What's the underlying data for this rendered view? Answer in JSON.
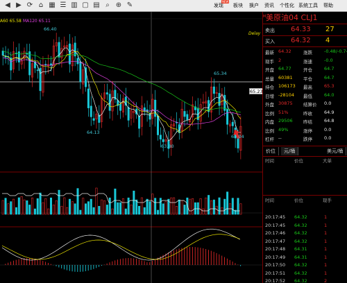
{
  "toolbar": {
    "buttons": [
      {
        "icon": "back-arrow-icon",
        "glyph": "◀"
      },
      {
        "icon": "forward-arrow-icon",
        "glyph": "▶"
      },
      {
        "icon": "refresh-icon",
        "glyph": "⟳"
      },
      {
        "icon": "home-icon",
        "glyph": "⌂"
      },
      {
        "icon": "grid-icon",
        "glyph": "▦"
      },
      {
        "icon": "list-icon",
        "glyph": "☰"
      },
      {
        "icon": "chart-icon",
        "glyph": "▥"
      },
      {
        "icon": "window-icon",
        "glyph": "▢"
      },
      {
        "icon": "layout-icon",
        "glyph": "▤"
      },
      {
        "icon": "search-icon",
        "glyph": "⌕"
      },
      {
        "icon": "zoom-in-icon",
        "glyph": "⊕"
      },
      {
        "icon": "pen-icon",
        "glyph": "✎"
      }
    ],
    "menus": [
      "发现",
      "板块",
      "换户",
      "资讯",
      "个性化",
      "系统工具",
      "帮助"
    ],
    "new_badge": "NEW"
  },
  "chart": {
    "ma_legend": [
      {
        "text": "A60 65.58",
        "color": "#e8e000"
      },
      {
        "text": "MA120 65.11",
        "color": "#e040e0"
      }
    ],
    "delay_label": "Delay",
    "current_price_tag": "65.23",
    "price_labels": [
      {
        "text": "66.40"
      },
      {
        "text": "65.34"
      },
      {
        "text": "64.13"
      },
      {
        "text": "63.80"
      },
      {
        "text": "64.04"
      }
    ]
  },
  "quote": {
    "m_badge": "M",
    "title": "美原油04 CLJ1",
    "sell": {
      "label": "卖出",
      "price": "64.33",
      "volume": "27"
    },
    "buy": {
      "label": "买入",
      "price": "64.32",
      "volume": "4"
    },
    "stats": [
      {
        "l": "最新",
        "v": "64.32",
        "vc": "red",
        "l2": "涨跌",
        "v2": "-0.48/-0.74",
        "v2c": "grn"
      },
      {
        "l": "现手",
        "v": "2",
        "vc": "red",
        "l2": "涨速",
        "v2": "-0.0",
        "v2c": "grn"
      },
      {
        "l": "开盘",
        "v": "64.77",
        "vc": "grn",
        "l2": "开仓",
        "v2": "64.7",
        "v2c": "grn"
      },
      {
        "l": "总量",
        "v": "60381",
        "vc": "yel",
        "l2": "平仓",
        "v2": "64.7",
        "v2c": "grn"
      },
      {
        "l": "持仓",
        "v": "106173",
        "vc": "yel",
        "l2": "最高",
        "v2": "65.3",
        "v2c": "red"
      },
      {
        "l": "日增",
        "v": "-28104",
        "vc": "yel",
        "l2": "最低",
        "v2": "64.0",
        "v2c": "grn"
      },
      {
        "l": "外盘",
        "v": "30875",
        "vc": "red",
        "l2": "结算价",
        "v2": "0.0",
        "v2c": "wht"
      },
      {
        "l": "比例",
        "v": "51%",
        "vc": "red",
        "l2": "昨收",
        "v2": "64.9",
        "v2c": "wht"
      },
      {
        "l": "内盘",
        "v": "29506",
        "vc": "grn",
        "l2": "昨结",
        "v2": "64.8",
        "v2c": "wht"
      },
      {
        "l": "比例",
        "v": "49%",
        "vc": "grn",
        "l2": "涨停",
        "v2": "0.0",
        "v2c": "wht"
      },
      {
        "l": "杠杆",
        "v": "--",
        "vc": "wht",
        "l2": "跌停",
        "v2": "0.0",
        "v2c": "wht"
      }
    ],
    "tabs": [
      {
        "label": "价位"
      },
      {
        "label": "元/桶"
      },
      {
        "label": "美元/桶"
      }
    ],
    "ticks_header": {
      "time": "时间",
      "price": "价位",
      "vol": "大单"
    },
    "ticks": [
      {
        "time": "20:17:45",
        "price": "64.32",
        "vol": "1"
      },
      {
        "time": "20:17:45",
        "price": "64.32",
        "vol": "1"
      },
      {
        "time": "20:17:46",
        "price": "64.32",
        "vol": "1"
      },
      {
        "time": "20:17:47",
        "price": "64.32",
        "vol": "1"
      },
      {
        "time": "20:17:48",
        "price": "64.31",
        "vol": "1"
      },
      {
        "time": "20:17:49",
        "price": "64.31",
        "vol": "1"
      },
      {
        "time": "20:17:50",
        "price": "64.32",
        "vol": "1"
      },
      {
        "time": "20:17:51",
        "price": "64.32",
        "vol": "1"
      },
      {
        "time": "20:17:52",
        "price": "64.32",
        "vol": "2"
      }
    ],
    "ticks_header2": {
      "time": "时间",
      "price": "价位",
      "vol": "现手"
    }
  },
  "colors": {
    "up": "#19c8d8",
    "down": "#e02828",
    "ma_white": "#e8e8e8",
    "ma_yellow": "#e8e000",
    "ma_magenta": "#e040e0",
    "ma_green": "#19c819"
  }
}
